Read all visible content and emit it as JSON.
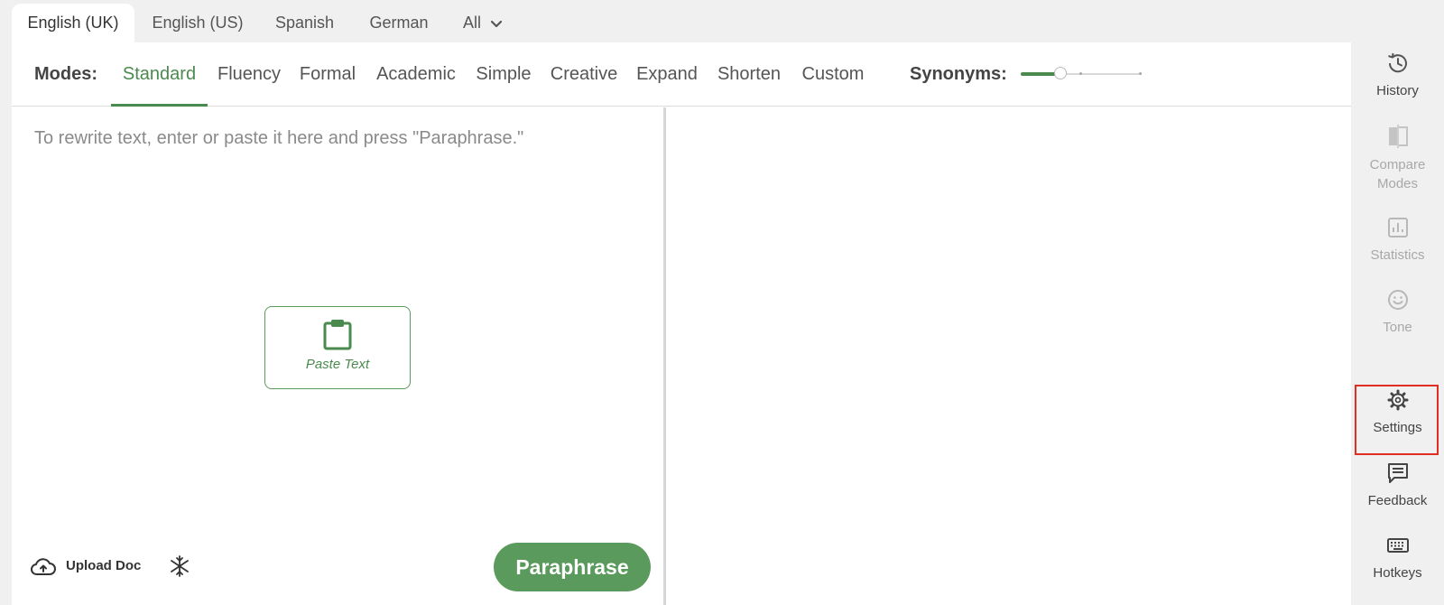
{
  "language_tabs": [
    {
      "label": "English (UK)",
      "active": true
    },
    {
      "label": "English (US)",
      "active": false
    },
    {
      "label": "Spanish",
      "active": false
    },
    {
      "label": "German",
      "active": false
    },
    {
      "label": "All",
      "active": false
    }
  ],
  "modes": {
    "label": "Modes:",
    "items": [
      {
        "label": "Standard",
        "active": true
      },
      {
        "label": "Fluency",
        "active": false
      },
      {
        "label": "Formal",
        "active": false
      },
      {
        "label": "Academic",
        "active": false
      },
      {
        "label": "Simple",
        "active": false
      },
      {
        "label": "Creative",
        "active": false
      },
      {
        "label": "Expand",
        "active": false
      },
      {
        "label": "Shorten",
        "active": false
      },
      {
        "label": "Custom",
        "active": false
      }
    ]
  },
  "synonyms": {
    "label": "Synonyms:",
    "level_fraction": 0.33
  },
  "editor": {
    "placeholder": "To rewrite text, enter or paste it here and press \"Paraphrase.\"",
    "paste_label": "Paste Text",
    "upload_label": "Upload Doc",
    "paraphrase_label": "Paraphrase"
  },
  "sidebar": {
    "items": [
      {
        "label": "History",
        "icon": "history-icon",
        "enabled": true
      },
      {
        "label": "Compare Modes",
        "icon": "compare-modes-icon",
        "enabled": false
      },
      {
        "label": "Statistics",
        "icon": "statistics-icon",
        "enabled": false
      },
      {
        "label": "Tone",
        "icon": "tone-icon",
        "enabled": false
      },
      {
        "label": "Settings",
        "icon": "gear-icon",
        "enabled": true,
        "highlighted": true
      },
      {
        "label": "Feedback",
        "icon": "feedback-icon",
        "enabled": true
      },
      {
        "label": "Hotkeys",
        "icon": "keyboard-icon",
        "enabled": true
      }
    ]
  },
  "colors": {
    "accent": "#4b8a4e",
    "highlight": "#e02f22"
  }
}
